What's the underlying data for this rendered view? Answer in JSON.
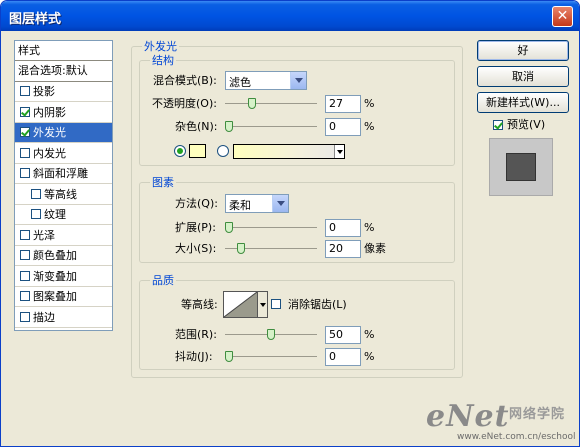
{
  "window": {
    "title": "图层样式",
    "close_glyph": "✕"
  },
  "styles_list": {
    "header": "样式",
    "blend": "混合选项:默认",
    "items": [
      {
        "label": "投影",
        "checked": false
      },
      {
        "label": "内阴影",
        "checked": true
      },
      {
        "label": "外发光",
        "checked": true,
        "selected": true
      },
      {
        "label": "内发光",
        "checked": false
      },
      {
        "label": "斜面和浮雕",
        "checked": false
      },
      {
        "label": "等高线",
        "checked": false,
        "indent": true
      },
      {
        "label": "纹理",
        "checked": false,
        "indent": true
      },
      {
        "label": "光泽",
        "checked": false
      },
      {
        "label": "颜色叠加",
        "checked": false
      },
      {
        "label": "渐变叠加",
        "checked": false
      },
      {
        "label": "图案叠加",
        "checked": false
      },
      {
        "label": "描边",
        "checked": false
      }
    ]
  },
  "panel": {
    "title": "外发光",
    "structure": {
      "title": "结构",
      "blend_mode_label": "混合模式(B):",
      "blend_mode_value": "滤色",
      "opacity_label": "不透明度(O):",
      "opacity_value": "27",
      "noise_label": "杂色(N):",
      "noise_value": "0",
      "percent": "%"
    },
    "elements": {
      "title": "图素",
      "technique_label": "方法(Q):",
      "technique_value": "柔和",
      "spread_label": "扩展(P):",
      "spread_value": "0",
      "size_label": "大小(S):",
      "size_value": "20",
      "percent": "%",
      "px_unit": "像素"
    },
    "quality": {
      "title": "品质",
      "contour_label": "等高线:",
      "anti_alias_label": "消除锯齿(L)",
      "range_label": "范围(R):",
      "range_value": "50",
      "jitter_label": "抖动(J):",
      "jitter_value": "0",
      "percent": "%"
    }
  },
  "buttons": {
    "ok": "好",
    "cancel": "取消",
    "new_style": "新建样式(W)...",
    "preview_label": "预览(V)"
  },
  "watermark": {
    "logo": "eNet",
    "sub": "网络学院",
    "url": "www.eNet.com.cn/eschool"
  }
}
